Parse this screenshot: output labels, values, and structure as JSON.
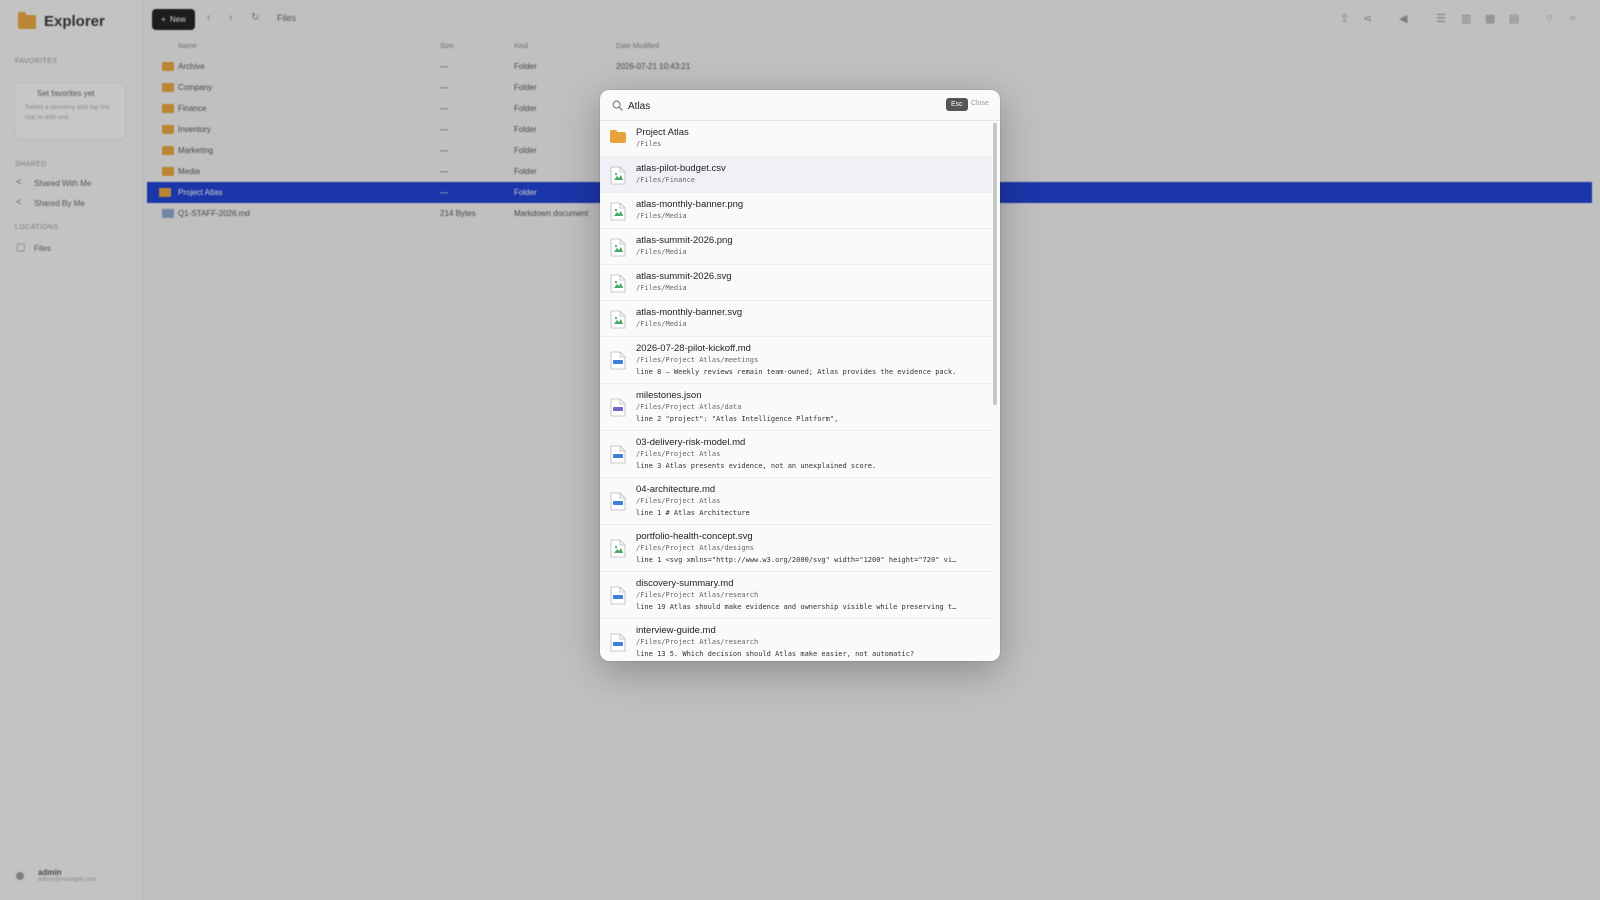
{
  "app": {
    "title": "Explorer",
    "new_button": "New",
    "breadcrumb": "Files",
    "nav": [
      "‹",
      "›",
      "↻"
    ]
  },
  "sidebar": {
    "favorites_heading": "Favorites",
    "favorites_title": "Set favorites yet",
    "favorites_hint": "Select a directory and tap the star to add one.",
    "shared_heading": "Shared",
    "shared_items": [
      "Shared With Me",
      "Shared By Me"
    ],
    "locations_heading": "Locations",
    "location_items": [
      "Files"
    ],
    "user_name": "admin",
    "user_email": "admin@example.com"
  },
  "table": {
    "headers": [
      "Name",
      "Size",
      "Kind",
      "Date Modified"
    ],
    "rows": [
      {
        "name": "Archive",
        "size": "—",
        "kind": "Folder",
        "date": "2026-07-21 10:43:21"
      },
      {
        "name": "Company",
        "size": "—",
        "kind": "Folder",
        "date": ""
      },
      {
        "name": "Finance",
        "size": "—",
        "kind": "Folder",
        "date": ""
      },
      {
        "name": "Inventory",
        "size": "—",
        "kind": "Folder",
        "date": ""
      },
      {
        "name": "Marketing",
        "size": "—",
        "kind": "Folder",
        "date": ""
      },
      {
        "name": "Media",
        "size": "—",
        "kind": "Folder",
        "date": ""
      },
      {
        "name": "Project Atlas",
        "size": "—",
        "kind": "Folder",
        "date": ""
      },
      {
        "name": "Q1-STAFF-2026.md",
        "size": "214 Bytes",
        "kind": "Markdown document",
        "date": ""
      }
    ]
  },
  "search": {
    "query": "Atlas",
    "esc_label": "Esc",
    "close_label": "Close",
    "results": [
      {
        "name": "Project Atlas",
        "path": "/Files",
        "line": "",
        "icon": "folder-icon"
      },
      {
        "name": "atlas-pilot-budget.csv",
        "path": "/Files/Finance",
        "line": "",
        "icon": "csv-file-icon"
      },
      {
        "name": "atlas-monthly-banner.png",
        "path": "/Files/Media",
        "line": "",
        "icon": "image-file-icon"
      },
      {
        "name": "atlas-summit-2026.png",
        "path": "/Files/Media",
        "line": "",
        "icon": "image-file-icon"
      },
      {
        "name": "atlas-summit-2026.svg",
        "path": "/Files/Media",
        "line": "",
        "icon": "image-file-icon"
      },
      {
        "name": "atlas-monthly-banner.svg",
        "path": "/Files/Media",
        "line": "",
        "icon": "image-file-icon"
      },
      {
        "name": "2026-07-28-pilot-kickoff.md",
        "path": "/Files/Project Atlas/meetings",
        "line": "line 8 — Weekly reviews remain team-owned; Atlas provides the evidence pack.",
        "icon": "markdown-file-icon"
      },
      {
        "name": "milestones.json",
        "path": "/Files/Project Atlas/data",
        "line": "line 2  \"project\": \"Atlas Intelligence Platform\",",
        "icon": "json-file-icon"
      },
      {
        "name": "03-delivery-risk-model.md",
        "path": "/Files/Project Atlas",
        "line": "line 3 Atlas presents evidence, not an unexplained score.",
        "icon": "markdown-file-icon"
      },
      {
        "name": "04-architecture.md",
        "path": "/Files/Project Atlas",
        "line": "line 1 # Atlas Architecture",
        "icon": "markdown-file-icon"
      },
      {
        "name": "portfolio-health-concept.svg",
        "path": "/Files/Project Atlas/designs",
        "line": "line 1 <svg xmlns=\"http://www.w3.org/2000/svg\" width=\"1200\" height=\"720\" vi…",
        "icon": "image-file-icon"
      },
      {
        "name": "discovery-summary.md",
        "path": "/Files/Project Atlas/research",
        "line": "line 19 Atlas should make evidence and ownership visible while preserving t…",
        "icon": "markdown-file-icon"
      },
      {
        "name": "interview-guide.md",
        "path": "/Files/Project Atlas/research",
        "line": "line 13 5. Which decision should Atlas make easier, not automatic?",
        "icon": "markdown-file-icon"
      }
    ]
  },
  "colors": {
    "accent": "#1a3dd0",
    "folder": "#e6a33a",
    "image_icon": "#4aa866",
    "doc_icon": "#3f7fd6",
    "json_icon": "#7d62c9"
  }
}
